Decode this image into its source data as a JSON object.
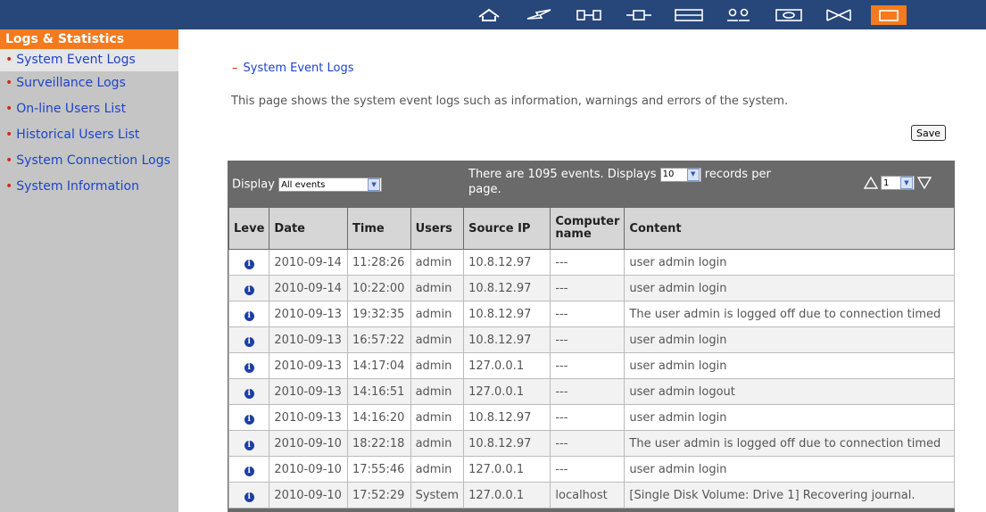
{
  "topbar": {
    "icons": [
      "home-icon",
      "lightning-icon",
      "network-icon",
      "device-icon",
      "storage-icon",
      "users-icon",
      "monitor-icon",
      "shuffle-icon",
      "logs-icon"
    ]
  },
  "sidebar": {
    "heading": "Logs & Statistics",
    "items": [
      {
        "label": "System Event Logs"
      },
      {
        "label": "Surveillance Logs"
      },
      {
        "label": "On-line Users List"
      },
      {
        "label": "Historical Users List"
      },
      {
        "label": "System Connection Logs"
      },
      {
        "label": "System Information"
      }
    ]
  },
  "main": {
    "title": "System Event Logs",
    "description": "This page shows the system event logs such as information, warnings and errors of the system.",
    "save_label": "Save"
  },
  "toolbar": {
    "display_label": "Display",
    "filter_value": "All events",
    "count_prefix": "There are 1095 events.  Displays",
    "per_page_value": "10",
    "count_suffix": "records per page.",
    "page_value": "1"
  },
  "table": {
    "headers": [
      "Leve",
      "Date",
      "Time",
      "Users",
      "Source IP",
      "Computer name",
      "Content"
    ],
    "rows": [
      {
        "date": "2010-09-14",
        "time": "11:28:26",
        "user": "admin",
        "ip": "10.8.12.97",
        "computer": "---",
        "content": "user admin login"
      },
      {
        "date": "2010-09-14",
        "time": "10:22:00",
        "user": "admin",
        "ip": "10.8.12.97",
        "computer": "---",
        "content": "user admin login"
      },
      {
        "date": "2010-09-13",
        "time": "19:32:35",
        "user": "admin",
        "ip": "10.8.12.97",
        "computer": "---",
        "content": "The user admin is logged off due to connection timed"
      },
      {
        "date": "2010-09-13",
        "time": "16:57:22",
        "user": "admin",
        "ip": "10.8.12.97",
        "computer": "---",
        "content": "user admin login"
      },
      {
        "date": "2010-09-13",
        "time": "14:17:04",
        "user": "admin",
        "ip": "127.0.0.1",
        "computer": "---",
        "content": "user admin login"
      },
      {
        "date": "2010-09-13",
        "time": "14:16:51",
        "user": "admin",
        "ip": "127.0.0.1",
        "computer": "---",
        "content": "user admin logout"
      },
      {
        "date": "2010-09-13",
        "time": "14:16:20",
        "user": "admin",
        "ip": "10.8.12.97",
        "computer": "---",
        "content": "user admin login"
      },
      {
        "date": "2010-09-10",
        "time": "18:22:18",
        "user": "admin",
        "ip": "10.8.12.97",
        "computer": "---",
        "content": "The user admin is logged off due to connection timed"
      },
      {
        "date": "2010-09-10",
        "time": "17:55:46",
        "user": "admin",
        "ip": "127.0.0.1",
        "computer": "---",
        "content": "user admin login"
      },
      {
        "date": "2010-09-10",
        "time": "17:52:29",
        "user": "System",
        "ip": "127.0.0.1",
        "computer": "localhost",
        "content": "[Single Disk Volume: Drive 1] Recovering journal."
      }
    ]
  },
  "colors": {
    "topbar": "#27467a",
    "accent": "#f47a20",
    "link": "#1e44c6",
    "bullet": "#d12a1a",
    "panel": "#6a6a6a"
  }
}
